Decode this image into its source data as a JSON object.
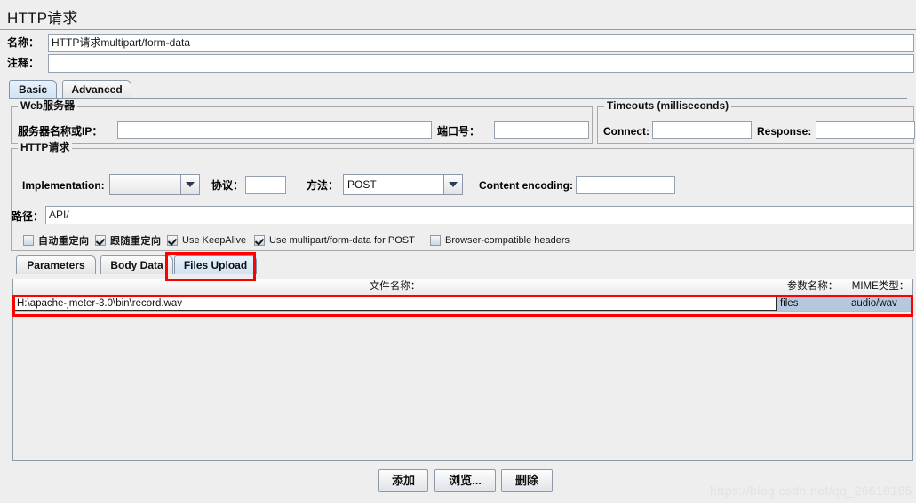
{
  "window": {
    "title": "HTTP请求"
  },
  "header": {
    "name_label": "名称：",
    "name_value": "HTTP请求multipart/form-data",
    "comment_label": "注释：",
    "comment_value": ""
  },
  "tabs_top": [
    {
      "label": "Basic",
      "selected": true
    },
    {
      "label": "Advanced",
      "selected": false
    }
  ],
  "web_server": {
    "legend": "Web服务器",
    "server_label": "服务器名称或IP：",
    "server_value": "",
    "port_label": "端口号：",
    "port_value": ""
  },
  "timeouts": {
    "legend": "Timeouts (milliseconds)",
    "connect_label": "Connect:",
    "connect_value": "",
    "response_label": "Response:",
    "response_value": ""
  },
  "http_request": {
    "legend": "HTTP请求",
    "implementation_label": "Implementation:",
    "implementation_value": "",
    "protocol_label": "协议：",
    "protocol_value": "",
    "method_label": "方法：",
    "method_value": "POST",
    "content_encoding_label": "Content encoding:",
    "content_encoding_value": "",
    "path_label": "路径：",
    "path_value": "API/"
  },
  "options": [
    {
      "label": "自动重定向",
      "checked": false,
      "cjk": true
    },
    {
      "label": "跟随重定向",
      "checked": true,
      "cjk": true
    },
    {
      "label": "Use KeepAlive",
      "checked": true,
      "cjk": false
    },
    {
      "label": "Use multipart/form-data for POST",
      "checked": true,
      "cjk": false
    },
    {
      "label": "Browser-compatible headers",
      "checked": false,
      "cjk": false
    }
  ],
  "tabs_bottom": [
    {
      "label": "Parameters",
      "selected": false
    },
    {
      "label": "Body Data",
      "selected": false
    },
    {
      "label": "Files Upload",
      "selected": true
    }
  ],
  "files_table": {
    "columns": [
      "文件名称：",
      "参数名称：",
      "MIME类型："
    ],
    "rows": [
      {
        "filename": "H:\\apache-jmeter-3.0\\bin\\record.wav",
        "parameter": "files",
        "mime": "audio/wav"
      }
    ]
  },
  "buttons": {
    "add": "添加",
    "browse": "浏览...",
    "delete": "删除"
  },
  "watermark": "https://blog.csdn.net/qq_26618185",
  "colors": {
    "panel_bg": "#eeeeee",
    "field_bg": "#ffffff",
    "selected_tab": "#d6e6f6",
    "row_selected": "#b6c8dd",
    "annotation": "#ff0000",
    "border": "#8e9aa8"
  }
}
